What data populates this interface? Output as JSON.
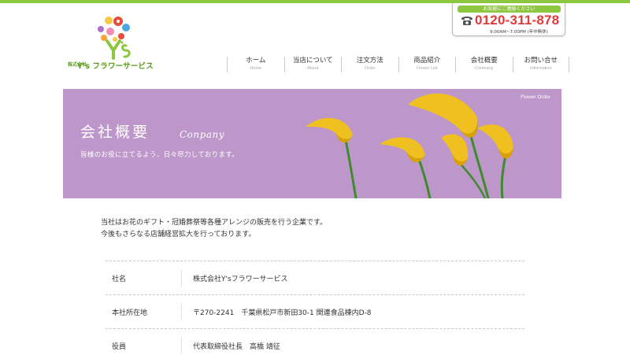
{
  "header": {
    "logo": {
      "kabushiki": "株式会社",
      "name": "Y's フラワーサービス"
    },
    "phone": {
      "banner": "お気軽にご連絡ください",
      "number": "0120-311-878",
      "hours": "9:00AM~7:00PM (年中無休)",
      "icon": "telephone-icon"
    }
  },
  "nav": [
    {
      "label": "ホーム",
      "sub": "Home"
    },
    {
      "label": "当店について",
      "sub": "About"
    },
    {
      "label": "注文方法",
      "sub": "Order"
    },
    {
      "label": "商品紹介",
      "sub": "Flower List"
    },
    {
      "label": "会社概要",
      "sub": "Conmany"
    },
    {
      "label": "お問い合せ",
      "sub": "Information"
    }
  ],
  "hero": {
    "tag": "Flower Order",
    "title": "会社概要",
    "title_en": "Conpany",
    "subtitle": "皆様のお役に立てるよう、日々尽力しております。",
    "background": "#bd97c9"
  },
  "intro": {
    "line1": "当社はお花のギフト・冠婚葬祭等各種アレンジの販売を行う企業です。",
    "line2": "今後もさらなる店舗経営拡大を行っております。"
  },
  "info": [
    {
      "label": "社名",
      "value": "株式会社Y'sフラワーサービス"
    },
    {
      "label": "本社所在地",
      "value": "〒270-2241　千葉県松戸市新田30-1 関連食品棟内D-8"
    },
    {
      "label": "役員",
      "value": "代表取締役社長　高橋 靖征"
    }
  ],
  "colors": {
    "accent": "#8dc63f",
    "phone": "#e03a3a"
  }
}
